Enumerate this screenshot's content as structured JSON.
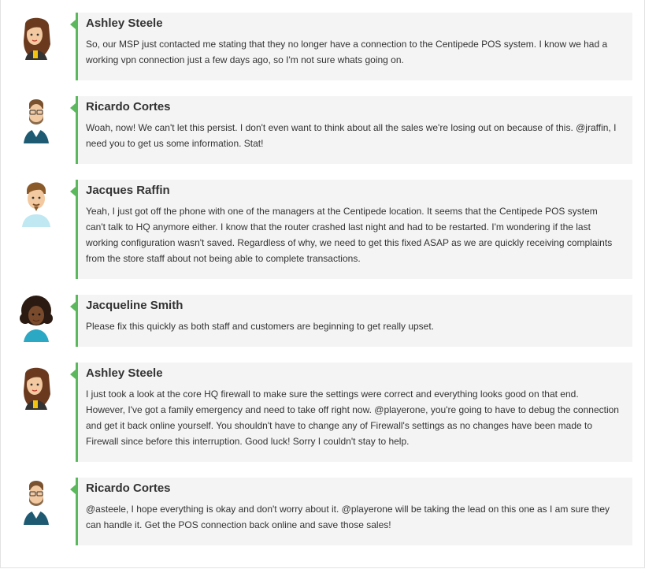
{
  "messages": [
    {
      "author": "Ashley Steele",
      "avatar": "female-avatar-brown-hair-icon",
      "text": "So, our MSP just contacted me stating that they no longer have a connection to the Centipede POS system. I know we had a working vpn connection just a few days ago, so I'm not sure whats going on."
    },
    {
      "author": "Ricardo Cortes",
      "avatar": "male-avatar-glasses-beard-icon",
      "text": "Woah, now! We can't let this persist. I don't even want to think about all the sales we're losing out on because of this. @jraffin, I need you to get us some information. Stat!"
    },
    {
      "author": "Jacques Raffin",
      "avatar": "male-avatar-goatee-icon",
      "text": "Yeah, I just got off the phone with one of the managers at the Centipede location. It seems that the Centipede POS system can't talk to HQ anymore either. I know that the router crashed last night and had to be restarted. I'm wondering if the last working configuration wasn't saved. Regardless of why, we need to get this fixed ASAP as we are quickly receiving complaints from the store staff about not being able to complete transactions."
    },
    {
      "author": "Jacqueline Smith",
      "avatar": "female-avatar-curly-hair-icon",
      "text": "Please fix this quickly as both staff and customers are beginning to get really upset."
    },
    {
      "author": "Ashley Steele",
      "avatar": "female-avatar-brown-hair-icon",
      "text": "I just took a look at the core HQ firewall to make sure the settings were correct and everything looks good on that end. However, I've got a family emergency and need to take off right now. @playerone, you're going to have to debug the connection and get it back online yourself. You shouldn't have to change any of Firewall's settings as no changes have been made to Firewall since before this interruption. Good luck! Sorry I couldn't stay to help."
    },
    {
      "author": "Ricardo Cortes",
      "avatar": "male-avatar-glasses-beard-icon",
      "text": "@asteele, I hope everything is okay and don't worry about it. @playerone will be taking the lead on this one as I am sure they can handle it. Get the POS connection back online and save those sales!"
    }
  ],
  "colors": {
    "accent": "#5cb85c",
    "bubble": "#f4f4f4",
    "text": "#333333"
  }
}
